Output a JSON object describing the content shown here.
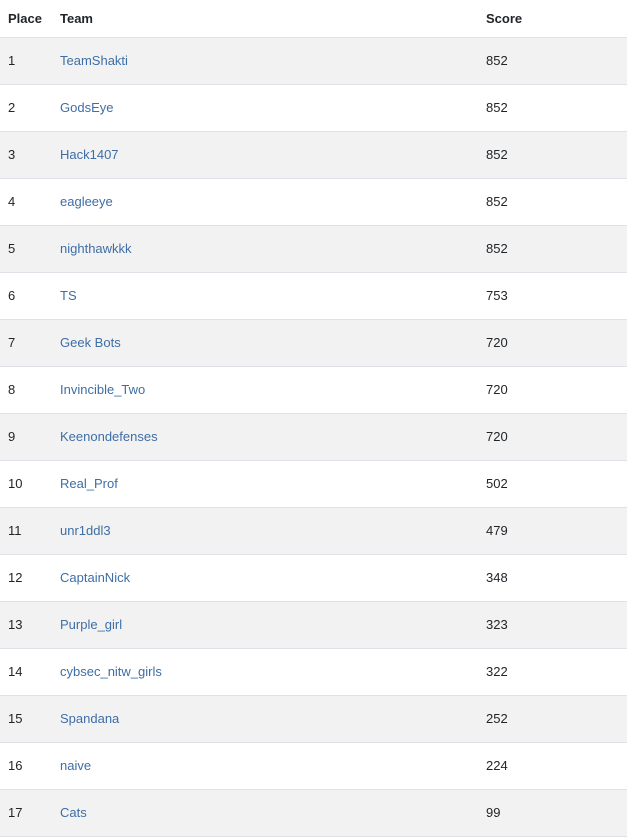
{
  "columns": {
    "place": "Place",
    "team": "Team",
    "score": "Score"
  },
  "link_color": "#3e6ea6",
  "rows": [
    {
      "place": "1",
      "team": "TeamShakti",
      "score": "852"
    },
    {
      "place": "2",
      "team": "GodsEye",
      "score": "852"
    },
    {
      "place": "3",
      "team": "Hack1407",
      "score": "852"
    },
    {
      "place": "4",
      "team": "eagleeye",
      "score": "852"
    },
    {
      "place": "5",
      "team": "nighthawkkk",
      "score": "852"
    },
    {
      "place": "6",
      "team": "TS",
      "score": "753"
    },
    {
      "place": "7",
      "team": "Geek Bots",
      "score": "720"
    },
    {
      "place": "8",
      "team": "Invincible_Two",
      "score": "720"
    },
    {
      "place": "9",
      "team": "Keenondefenses",
      "score": "720"
    },
    {
      "place": "10",
      "team": "Real_Prof",
      "score": "502"
    },
    {
      "place": "11",
      "team": "unr1ddl3",
      "score": "479"
    },
    {
      "place": "12",
      "team": "CaptainNick",
      "score": "348"
    },
    {
      "place": "13",
      "team": "Purple_girl",
      "score": "323"
    },
    {
      "place": "14",
      "team": "cybsec_nitw_girls",
      "score": "322"
    },
    {
      "place": "15",
      "team": "Spandana",
      "score": "252"
    },
    {
      "place": "16",
      "team": "naive",
      "score": "224"
    },
    {
      "place": "17",
      "team": "Cats",
      "score": "99"
    }
  ]
}
